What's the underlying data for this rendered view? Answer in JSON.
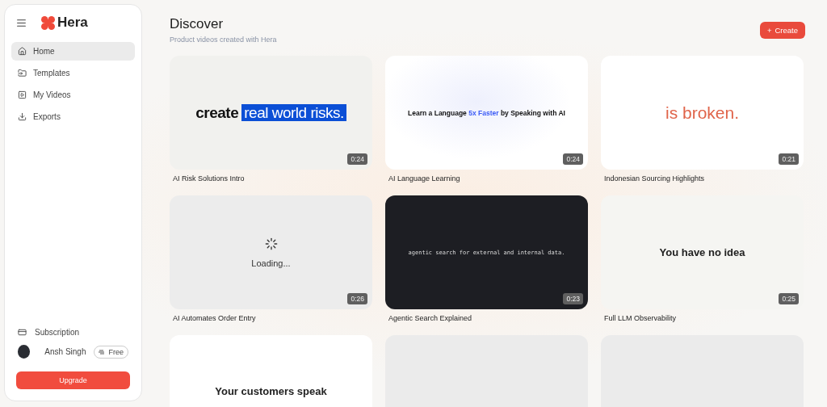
{
  "brand": {
    "name": "Hera"
  },
  "sidebar": {
    "items": [
      {
        "label": "Home",
        "selected": true
      },
      {
        "label": "Templates",
        "selected": false
      },
      {
        "label": "My Videos",
        "selected": false
      },
      {
        "label": "Exports",
        "selected": false
      }
    ],
    "subscription": {
      "label": "Subscription"
    },
    "user": {
      "name": "Ansh Singh",
      "plan": "Free"
    },
    "upgrade_button": "Upgrade"
  },
  "header": {
    "title": "Discover",
    "subtitle": "Product videos created with Hera",
    "create_button": {
      "icon": "+",
      "label": "Create"
    }
  },
  "videos": [
    {
      "title": "AI Risk Solutions Intro",
      "duration": "0:24",
      "thumb": {
        "kind": "highlight",
        "segments": [
          {
            "text": "create",
            "kind": "plain"
          },
          {
            "text": "real world risks.",
            "kind": "marked"
          }
        ]
      }
    },
    {
      "title": "AI Language Learning",
      "duration": "0:24",
      "thumb": {
        "kind": "glow",
        "segments": [
          {
            "text": "Learn a Language ",
            "kind": "plain"
          },
          {
            "text": "5x Faster",
            "kind": "accent"
          },
          {
            "text": " by Speaking with AI",
            "kind": "plain"
          }
        ]
      }
    },
    {
      "title": "Indonesian Sourcing Highlights",
      "duration": "0:21",
      "thumb": {
        "kind": "brand",
        "segments": [
          {
            "text": "is broken.",
            "kind": "plain"
          }
        ]
      }
    },
    {
      "title": "AI Automates Order Entry",
      "duration": "0:26",
      "thumb": {
        "kind": "loading",
        "segments": [
          {
            "text": "Loading...",
            "kind": "plain"
          }
        ]
      }
    },
    {
      "title": "Agentic Search Explained",
      "duration": "0:23",
      "thumb": {
        "kind": "terminal",
        "segments": [
          {
            "text": "agentic search for external and internal data.",
            "kind": "plain"
          }
        ]
      }
    },
    {
      "title": "Full LLM Observability",
      "duration": "0:25",
      "thumb": {
        "kind": "plain",
        "segments": [
          {
            "text": "You have no idea",
            "kind": "plain"
          }
        ]
      }
    },
    {
      "thumb": {
        "kind": "white",
        "segments": [
          {
            "text": "Your customers speak",
            "kind": "plain"
          }
        ]
      }
    },
    {
      "thumb": {
        "kind": "blank"
      }
    },
    {
      "thumb": {
        "kind": "blank"
      }
    }
  ]
}
